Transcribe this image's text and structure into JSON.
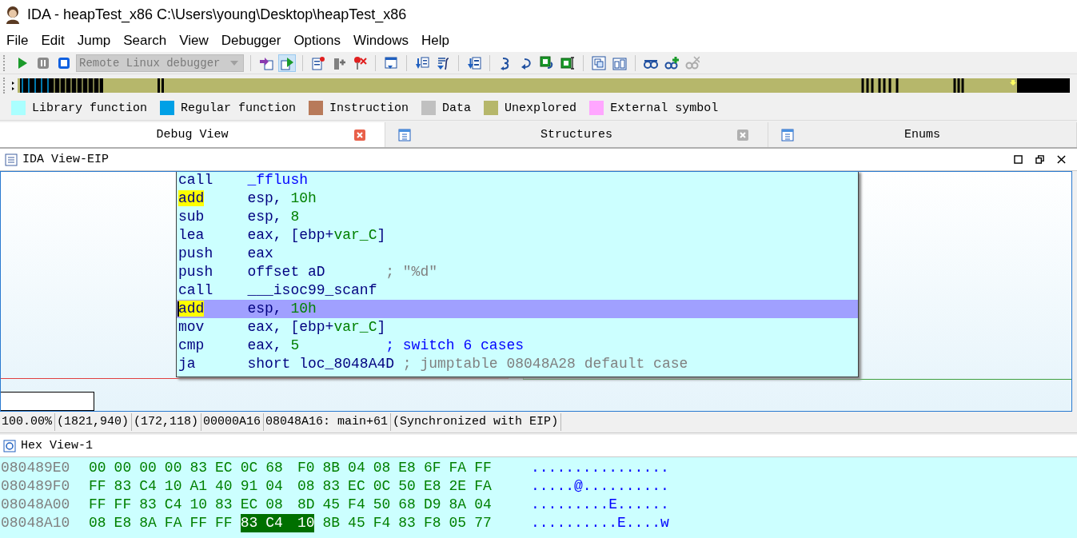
{
  "window": {
    "title": "IDA - heapTest_x86 C:\\Users\\young\\Desktop\\heapTest_x86"
  },
  "menu": [
    "File",
    "Edit",
    "Jump",
    "Search",
    "View",
    "Debugger",
    "Options",
    "Windows",
    "Help"
  ],
  "toolbar": [
    {
      "kind": "run",
      "selected": false,
      "disabled": false
    },
    {
      "kind": "pause",
      "selected": false,
      "disabled": false
    },
    {
      "kind": "stop",
      "selected": false,
      "disabled": false
    },
    {
      "kind": "dropdown",
      "value": "Remote Linux debugger",
      "disabled": true
    },
    {
      "kind": "separator"
    },
    {
      "kind": "attach",
      "selected": false,
      "disabled": false
    },
    {
      "kind": "attach-run",
      "selected": true,
      "disabled": false
    },
    {
      "kind": "separator"
    },
    {
      "kind": "bp-list",
      "selected": false,
      "disabled": false
    },
    {
      "kind": "bp-add",
      "selected": false,
      "disabled": false
    },
    {
      "kind": "bp-del",
      "selected": false,
      "disabled": false
    },
    {
      "kind": "separator"
    },
    {
      "kind": "view",
      "selected": false,
      "disabled": false
    },
    {
      "kind": "separator"
    },
    {
      "kind": "list-down",
      "selected": false,
      "disabled": false
    },
    {
      "kind": "func-down",
      "selected": false,
      "disabled": false
    },
    {
      "kind": "separator"
    },
    {
      "kind": "stack-down",
      "selected": false,
      "disabled": false
    },
    {
      "kind": "separator"
    },
    {
      "kind": "step-into",
      "selected": false,
      "disabled": false
    },
    {
      "kind": "step-over",
      "selected": false,
      "disabled": false
    },
    {
      "kind": "run-to",
      "selected": false,
      "disabled": false
    },
    {
      "kind": "run-cursor",
      "selected": false,
      "disabled": false
    },
    {
      "kind": "separator"
    },
    {
      "kind": "windows",
      "selected": false,
      "disabled": false
    },
    {
      "kind": "panels",
      "selected": false,
      "disabled": false
    },
    {
      "kind": "separator"
    },
    {
      "kind": "watch",
      "selected": false,
      "disabled": false
    },
    {
      "kind": "watch-add",
      "selected": false,
      "disabled": false
    },
    {
      "kind": "watch-del",
      "selected": false,
      "disabled": true
    }
  ],
  "legend": [
    {
      "label": "Library function",
      "color": "#aaffff"
    },
    {
      "label": "Regular function",
      "color": "#00a0e6"
    },
    {
      "label": "Instruction",
      "color": "#b87a5a"
    },
    {
      "label": "Data",
      "color": "#c0c0c0"
    },
    {
      "label": "Unexplored",
      "color": "#b6b76b"
    },
    {
      "label": "External symbol",
      "color": "#ffa6ff"
    }
  ],
  "tabs": [
    {
      "label": "Debug View",
      "selected": true,
      "icon": false,
      "close_enabled": true
    },
    {
      "label": "Structures",
      "selected": false,
      "icon": true,
      "close_enabled": false
    },
    {
      "label": "Enums",
      "selected": false,
      "icon": true
    }
  ],
  "ida_view": {
    "title": "IDA View-EIP",
    "listing": [
      {
        "mnemonic": "call",
        "highlighted": false,
        "selected": false,
        "operands": [
          {
            "t": "_fflush",
            "kind": "name"
          }
        ]
      },
      {
        "mnemonic": "add",
        "highlighted": true,
        "selected": false,
        "operands": [
          {
            "t": "esp, ",
            "kind": "plain"
          },
          {
            "t": "10h",
            "kind": "num"
          }
        ]
      },
      {
        "mnemonic": "sub",
        "highlighted": false,
        "selected": false,
        "operands": [
          {
            "t": "esp, ",
            "kind": "plain"
          },
          {
            "t": "8",
            "kind": "num"
          }
        ]
      },
      {
        "mnemonic": "lea",
        "highlighted": false,
        "selected": false,
        "operands": [
          {
            "t": "eax, [ebp+",
            "kind": "plain"
          },
          {
            "t": "var_C",
            "kind": "num"
          },
          {
            "t": "]",
            "kind": "plain"
          }
        ]
      },
      {
        "mnemonic": "push",
        "highlighted": false,
        "selected": false,
        "operands": [
          {
            "t": "eax",
            "kind": "plain"
          }
        ]
      },
      {
        "mnemonic": "push",
        "highlighted": false,
        "selected": false,
        "operands": [
          {
            "t": "offset aD",
            "kind": "plain"
          }
        ],
        "comment": {
          "text": "; \"%d\"",
          "kind": "auto"
        }
      },
      {
        "mnemonic": "call",
        "highlighted": false,
        "selected": false,
        "operands": [
          {
            "t": "___isoc99_scanf",
            "kind": "plain"
          }
        ]
      },
      {
        "mnemonic": "add",
        "highlighted": true,
        "selected": true,
        "operands": [
          {
            "t": "esp, ",
            "kind": "plain"
          },
          {
            "t": "10h",
            "kind": "num"
          }
        ]
      },
      {
        "mnemonic": "mov",
        "highlighted": false,
        "selected": false,
        "operands": [
          {
            "t": "eax, [ebp+",
            "kind": "plain"
          },
          {
            "t": "var_C",
            "kind": "num"
          },
          {
            "t": "]",
            "kind": "plain"
          }
        ]
      },
      {
        "mnemonic": "cmp",
        "highlighted": false,
        "selected": false,
        "operands": [
          {
            "t": "eax, ",
            "kind": "plain"
          },
          {
            "t": "5",
            "kind": "num"
          }
        ],
        "comment": {
          "text": "; switch 6 cases",
          "kind": "user"
        }
      },
      {
        "mnemonic": "ja",
        "highlighted": false,
        "selected": false,
        "operands": [
          {
            "t": "short loc_8048A4D",
            "kind": "plain"
          }
        ],
        "comment": {
          "text": "; jumptable 08048A28 default case",
          "kind": "auto"
        }
      }
    ],
    "status": [
      "100.00%",
      "(1821,940)",
      "(172,118)",
      "00000A16",
      "08048A16: main+61",
      "(Synchronized with EIP)"
    ]
  },
  "hex_view": {
    "title": "Hex View-1",
    "rows": [
      {
        "address": "080489E0",
        "bytes": [
          {
            "v": "00",
            "selected": false
          },
          {
            "v": "00",
            "selected": false
          },
          {
            "v": "00",
            "selected": false
          },
          {
            "v": "00",
            "selected": false
          },
          {
            "v": "83",
            "selected": false
          },
          {
            "v": "EC",
            "selected": false
          },
          {
            "v": "0C",
            "selected": false
          },
          {
            "v": "68",
            "selected": false
          },
          {
            "v": "F0",
            "selected": false
          },
          {
            "v": "8B",
            "selected": false
          },
          {
            "v": "04",
            "selected": false
          },
          {
            "v": "08",
            "selected": false
          },
          {
            "v": "E8",
            "selected": false
          },
          {
            "v": "6F",
            "selected": false
          },
          {
            "v": "FA",
            "selected": false
          },
          {
            "v": "FF",
            "selected": false
          }
        ],
        "ascii": "................"
      },
      {
        "address": "080489F0",
        "bytes": [
          {
            "v": "FF",
            "selected": false
          },
          {
            "v": "83",
            "selected": false
          },
          {
            "v": "C4",
            "selected": false
          },
          {
            "v": "10",
            "selected": false
          },
          {
            "v": "A1",
            "selected": false
          },
          {
            "v": "40",
            "selected": false
          },
          {
            "v": "91",
            "selected": false
          },
          {
            "v": "04",
            "selected": false
          },
          {
            "v": "08",
            "selected": false
          },
          {
            "v": "83",
            "selected": false
          },
          {
            "v": "EC",
            "selected": false
          },
          {
            "v": "0C",
            "selected": false
          },
          {
            "v": "50",
            "selected": false
          },
          {
            "v": "E8",
            "selected": false
          },
          {
            "v": "2E",
            "selected": false
          },
          {
            "v": "FA",
            "selected": false
          }
        ],
        "ascii": ".....@.........."
      },
      {
        "address": "08048A00",
        "bytes": [
          {
            "v": "FF",
            "selected": false
          },
          {
            "v": "FF",
            "selected": false
          },
          {
            "v": "83",
            "selected": false
          },
          {
            "v": "C4",
            "selected": false
          },
          {
            "v": "10",
            "selected": false
          },
          {
            "v": "83",
            "selected": false
          },
          {
            "v": "EC",
            "selected": false
          },
          {
            "v": "08",
            "selected": false
          },
          {
            "v": "8D",
            "selected": false
          },
          {
            "v": "45",
            "selected": false
          },
          {
            "v": "F4",
            "selected": false
          },
          {
            "v": "50",
            "selected": false
          },
          {
            "v": "68",
            "selected": false
          },
          {
            "v": "D9",
            "selected": false
          },
          {
            "v": "8A",
            "selected": false
          },
          {
            "v": "04",
            "selected": false
          }
        ],
        "ascii": ".........E......"
      },
      {
        "address": "08048A10",
        "bytes": [
          {
            "v": "08",
            "selected": false
          },
          {
            "v": "E8",
            "selected": false
          },
          {
            "v": "8A",
            "selected": false
          },
          {
            "v": "FA",
            "selected": false
          },
          {
            "v": "FF",
            "selected": false
          },
          {
            "v": "FF",
            "selected": false
          },
          {
            "v": "83",
            "selected": true
          },
          {
            "v": "C4",
            "selected": true
          },
          {
            "v": "10",
            "selected": true
          },
          {
            "v": "8B",
            "selected": false
          },
          {
            "v": "45",
            "selected": false
          },
          {
            "v": "F4",
            "selected": false
          },
          {
            "v": "83",
            "selected": false
          },
          {
            "v": "F8",
            "selected": false
          },
          {
            "v": "05",
            "selected": false
          },
          {
            "v": "77",
            "selected": false
          }
        ],
        "ascii": "..........E....w"
      }
    ]
  }
}
